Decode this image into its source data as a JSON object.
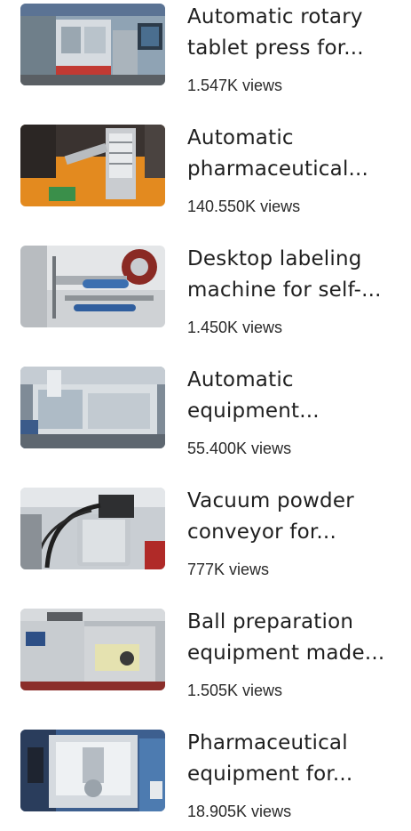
{
  "videos": [
    {
      "title_line1": "Automatic rotary",
      "title_line2": "tablet press for...",
      "views": "1.547K views",
      "thumbnail": "tablet-press-machine"
    },
    {
      "title_line1": "Automatic",
      "title_line2": "pharmaceutical...",
      "views": "140.550K views",
      "thumbnail": "pharmaceutical-machine"
    },
    {
      "title_line1": "Desktop labeling",
      "title_line2": "machine for self-...",
      "views": "1.450K views",
      "thumbnail": "labeling-machine"
    },
    {
      "title_line1": "Automatic",
      "title_line2": "equipment...",
      "views": "55.400K views",
      "thumbnail": "automatic-equipment"
    },
    {
      "title_line1": "Vacuum powder",
      "title_line2": "conveyor for...",
      "views": "777K views",
      "thumbnail": "vacuum-powder-conveyor"
    },
    {
      "title_line1": "Ball preparation",
      "title_line2": "equipment made...",
      "views": "1.505K views",
      "thumbnail": "ball-preparation-equipment"
    },
    {
      "title_line1": "Pharmaceutical",
      "title_line2": "equipment for...",
      "views": "18.905K views",
      "thumbnail": "pharmaceutical-equipment"
    }
  ]
}
